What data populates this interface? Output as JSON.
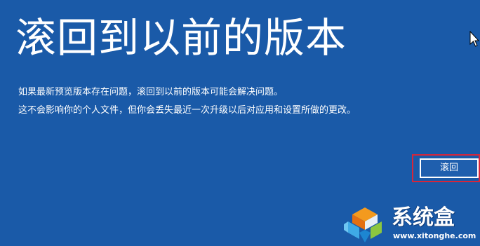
{
  "page": {
    "title": "滚回到以前的版本",
    "description_line1": "如果最新预览版本存在问题，滚回到以前的版本可能会解决问题。",
    "description_line2": "这不会影响你的个人文件，但你会丢失最近一次升级以后对应用和设置所做的更改。",
    "background_color": "#1a5aa8"
  },
  "actions": {
    "rollback_label": "滚回",
    "highlight_color": "#d7263a"
  },
  "watermark": {
    "name": "系统盒",
    "url": "www.xitonghe.com",
    "logo_icon": "cube-logo-icon"
  },
  "pointer": {
    "icon": "mouse-cursor-icon"
  }
}
